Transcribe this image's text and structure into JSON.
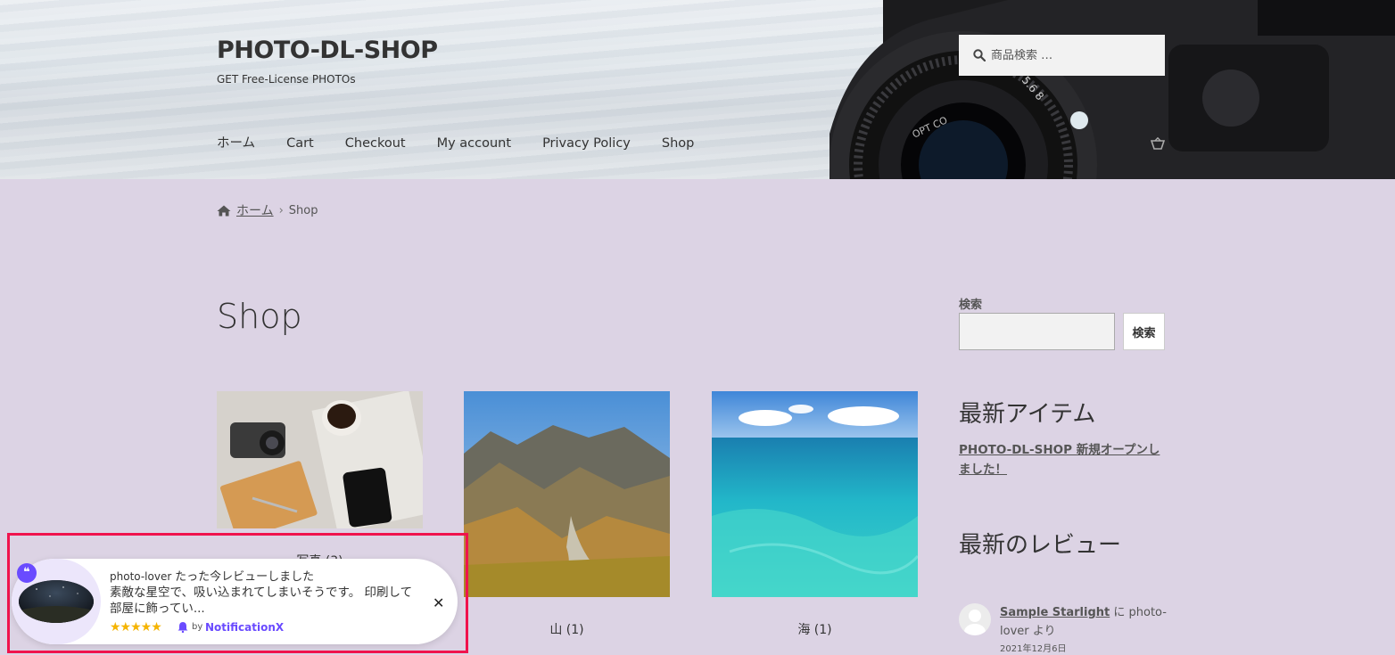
{
  "header": {
    "site_title": "PHOTO-DL-SHOP",
    "tagline": "GET Free-License PHOTOs",
    "nav": [
      "ホーム",
      "Cart",
      "Checkout",
      "My account",
      "Privacy Policy",
      "Shop"
    ],
    "search_placeholder": "商品検索 …"
  },
  "breadcrumb": {
    "home": "ホーム",
    "separator": "›",
    "current": "Shop"
  },
  "main": {
    "page_title": "Shop",
    "products": [
      {
        "label": "写真 (3)"
      },
      {
        "label": "山 (1)"
      },
      {
        "label": "海 (1)"
      }
    ]
  },
  "sidebar": {
    "search_label": "検索",
    "search_button": "検索",
    "recent_items_title": "最新アイテム",
    "recent_item": "PHOTO-DL-SHOP 新規オープンしました！",
    "recent_reviews_title": "最新のレビュー",
    "review": {
      "product": "Sample Starlight",
      "connector": " に photo-lover より",
      "date": "2021年12月6日"
    }
  },
  "notification": {
    "user": "photo-lover",
    "action": "たった今レビューしました",
    "text": "素敵な星空で、吸い込まれてしまいそうです。 印刷して部屋に飾ってい...",
    "rating": 5,
    "stars": "★★★★★",
    "by": "by",
    "brand": "NotificationX",
    "close": "✕"
  },
  "colors": {
    "page_bg": "#dcd3e4",
    "highlight_border": "#f0134d",
    "brand_purple": "#6a4bff",
    "star": "#f5b400"
  },
  "icons": {
    "search": "search-icon",
    "home": "home-icon",
    "cart": "cart-icon",
    "quote": "quote-icon",
    "close": "close-icon",
    "bell": "bell-icon"
  }
}
